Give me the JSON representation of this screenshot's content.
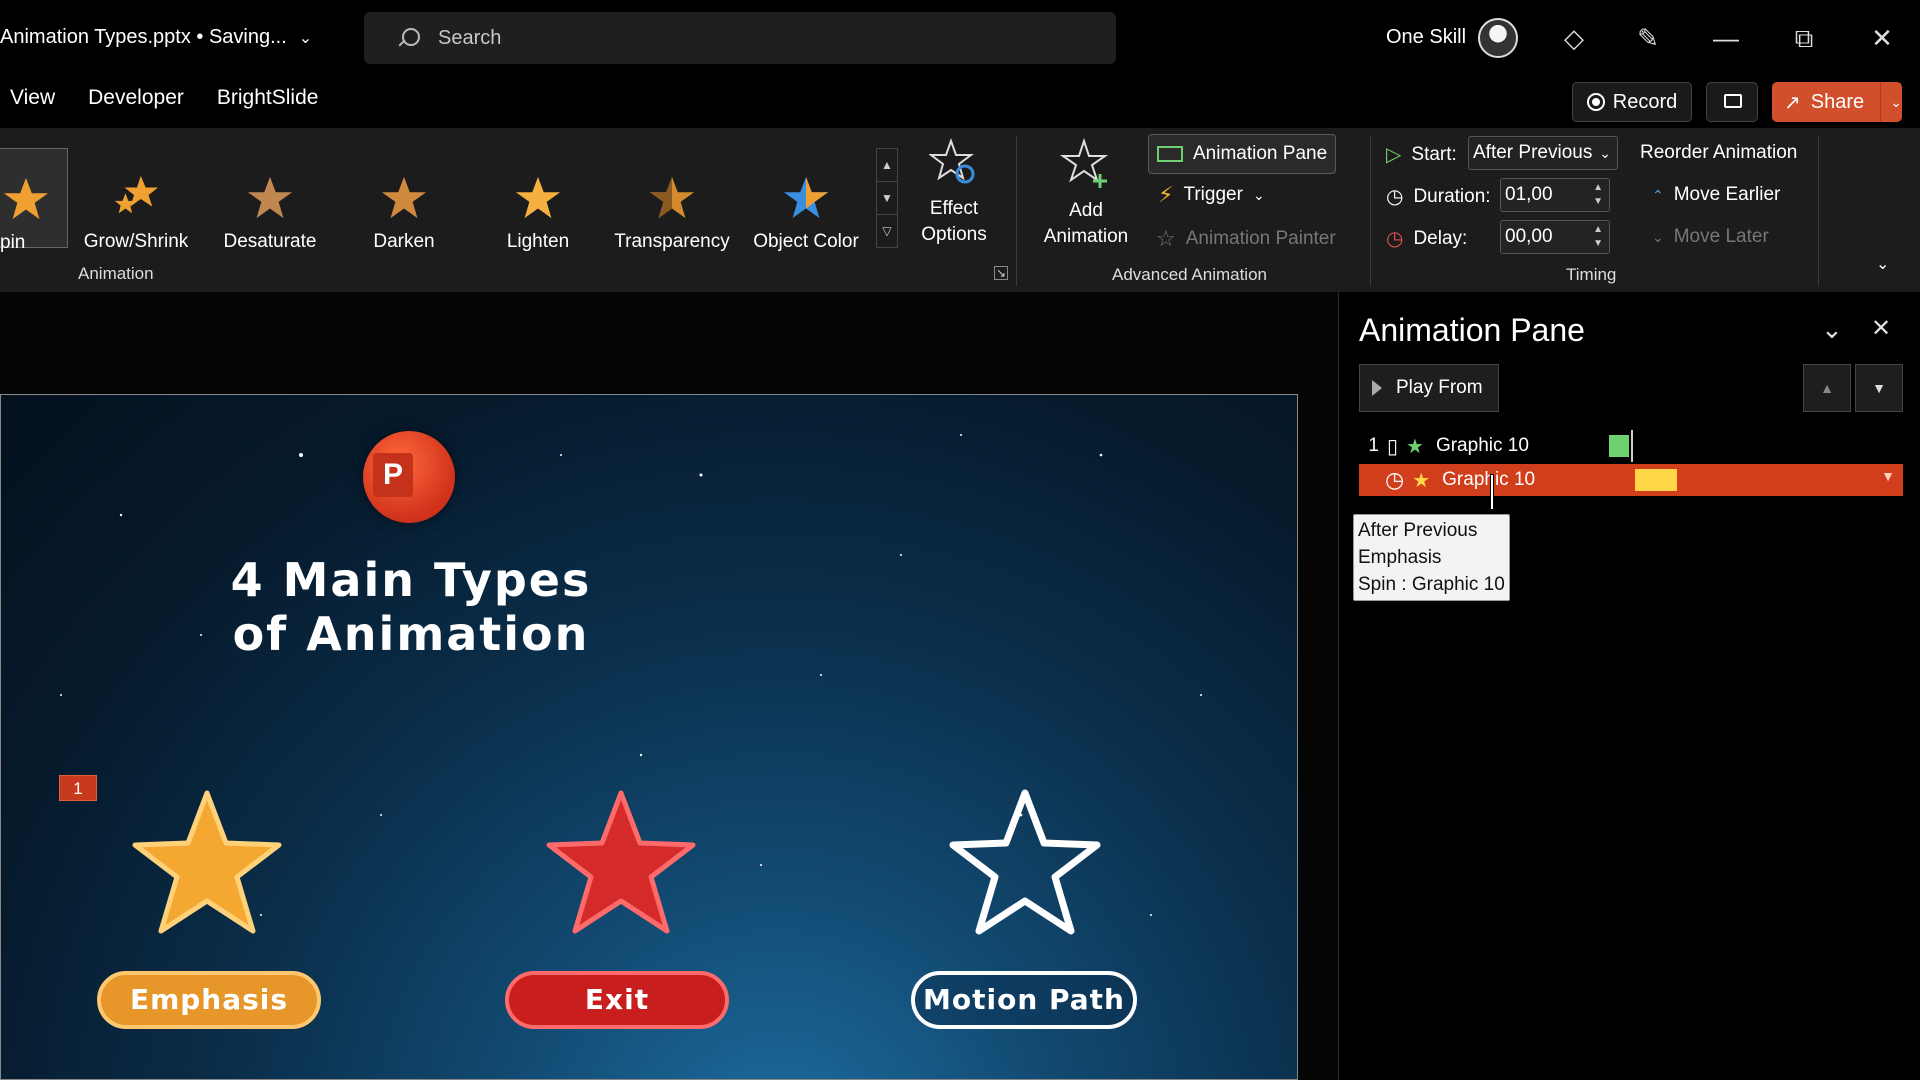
{
  "window": {
    "doc_title": "Animation Types.pptx • Saving...",
    "search_placeholder": "Search",
    "account_name": "One Skill"
  },
  "tabs": [
    "View",
    "Developer",
    "BrightSlide"
  ],
  "actions": {
    "record": "Record",
    "share": "Share"
  },
  "ribbon": {
    "animation_gallery": [
      {
        "label": "pin",
        "color": "#f0a030",
        "selected": true
      },
      {
        "label": "Grow/Shrink",
        "color": "#f0a030"
      },
      {
        "label": "Desaturate",
        "color": "#c08850"
      },
      {
        "label": "Darken",
        "color": "#d08a40"
      },
      {
        "label": "Lighten",
        "color": "#f5b040"
      },
      {
        "label": "Transparency",
        "color": "#d68a30"
      },
      {
        "label": "Object Color",
        "color": "#3a8ee0"
      }
    ],
    "effect_options": "Effect Options",
    "animation_group_label": "Animation",
    "add_animation": "Add Animation",
    "animation_pane_btn": "Animation Pane",
    "trigger": "Trigger",
    "animation_painter": "Animation Painter",
    "advanced_group_label": "Advanced Animation",
    "start_label": "Start:",
    "start_value": "After Previous",
    "duration_label": "Duration:",
    "duration_value": "01,00",
    "delay_label": "Delay:",
    "delay_value": "00,00",
    "timing_group_label": "Timing",
    "reorder_title": "Reorder Animation",
    "move_earlier": "Move Earlier",
    "move_later": "Move Later"
  },
  "slide": {
    "title_line1": "4 Main Types",
    "title_line2": "of Animation",
    "anim_tag": "1",
    "logo_letter": "P",
    "items": [
      {
        "label": "Emphasis",
        "star_color": "#f4a832"
      },
      {
        "label": "Exit",
        "star_color": "#d42a2a"
      },
      {
        "label": "Motion Path",
        "star_color": "none"
      }
    ]
  },
  "pane": {
    "title": "Animation Pane",
    "play_from": "Play From",
    "rows": [
      {
        "index": "1",
        "name": "Graphic 10",
        "bar_color": "#6fd06f"
      },
      {
        "index": "",
        "name": "Graphic 10",
        "bar_color": "#ffd84a"
      }
    ],
    "tooltip_line1": "After Previous",
    "tooltip_line2": "Emphasis",
    "tooltip_line3": "Spin : Graphic 10"
  }
}
